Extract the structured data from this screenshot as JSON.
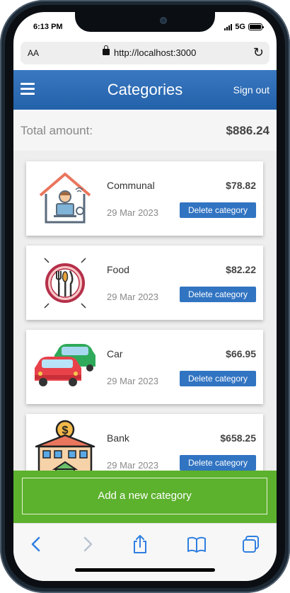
{
  "status": {
    "time": "6:13 PM",
    "network": "5G"
  },
  "browser": {
    "text_size_label": "AA",
    "url": "http://localhost:3000"
  },
  "header": {
    "title": "Categories",
    "sign_out_label": "Sign out"
  },
  "total": {
    "label": "Total amount:",
    "value": "$886.24"
  },
  "categories": [
    {
      "name": "Communal",
      "amount": "$78.82",
      "date": "29 Mar 2023",
      "delete_label": "Delete category",
      "icon": "home-office-icon"
    },
    {
      "name": "Food",
      "amount": "$82.22",
      "date": "29 Mar 2023",
      "delete_label": "Delete category",
      "icon": "restaurant-icon"
    },
    {
      "name": "Car",
      "amount": "$66.95",
      "date": "29 Mar 2023",
      "delete_label": "Delete category",
      "icon": "cars-icon"
    },
    {
      "name": "Bank",
      "amount": "$658.25",
      "date": "29 Mar 2023",
      "delete_label": "Delete category",
      "icon": "bank-icon"
    }
  ],
  "add_button_label": "Add a new category",
  "colors": {
    "header": "#2b6cb5",
    "delete_button": "#3174c2",
    "add_bar": "#5cb12d"
  }
}
